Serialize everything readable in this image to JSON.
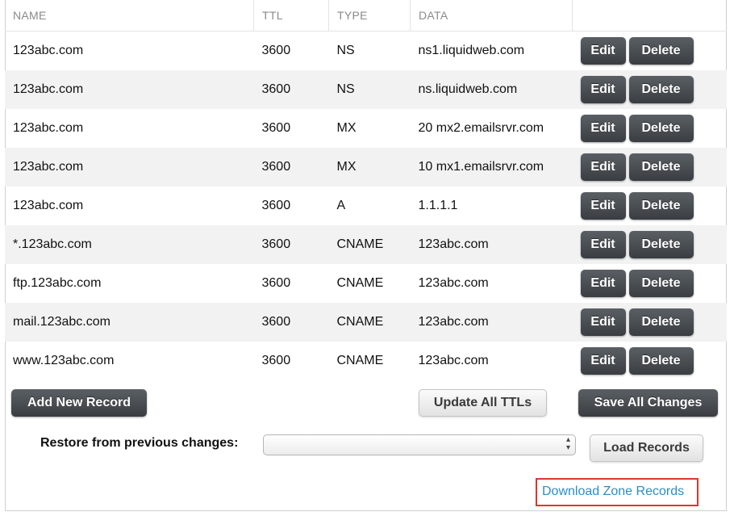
{
  "table": {
    "headers": {
      "name": "NAME",
      "ttl": "TTL",
      "type": "TYPE",
      "data": "DATA"
    },
    "edit_label": "Edit",
    "delete_label": "Delete",
    "rows": [
      {
        "name": "123abc.com",
        "ttl": "3600",
        "type": "NS",
        "data": "ns1.liquidweb.com"
      },
      {
        "name": "123abc.com",
        "ttl": "3600",
        "type": "NS",
        "data": "ns.liquidweb.com"
      },
      {
        "name": "123abc.com",
        "ttl": "3600",
        "type": "MX",
        "data": "20 mx2.emailsrvr.com"
      },
      {
        "name": "123abc.com",
        "ttl": "3600",
        "type": "MX",
        "data": "10 mx1.emailsrvr.com"
      },
      {
        "name": "123abc.com",
        "ttl": "3600",
        "type": "A",
        "data": "1.1.1.1"
      },
      {
        "name": "*.123abc.com",
        "ttl": "3600",
        "type": "CNAME",
        "data": "123abc.com"
      },
      {
        "name": "ftp.123abc.com",
        "ttl": "3600",
        "type": "CNAME",
        "data": "123abc.com"
      },
      {
        "name": "mail.123abc.com",
        "ttl": "3600",
        "type": "CNAME",
        "data": "123abc.com"
      },
      {
        "name": "www.123abc.com",
        "ttl": "3600",
        "type": "CNAME",
        "data": "123abc.com"
      }
    ]
  },
  "buttons": {
    "add_new_record": "Add New Record",
    "update_all_ttls": "Update All TTLs",
    "save_all_changes": "Save All Changes",
    "load_records": "Load Records"
  },
  "restore": {
    "label": "Restore from previous changes:",
    "selected_value": ""
  },
  "download_link": "Download Zone Records",
  "colors": {
    "dark_button": "#3f4348",
    "link": "#2a8ec9",
    "highlight_box": "#e0342c",
    "row_stripe": "#f2f2f2"
  }
}
